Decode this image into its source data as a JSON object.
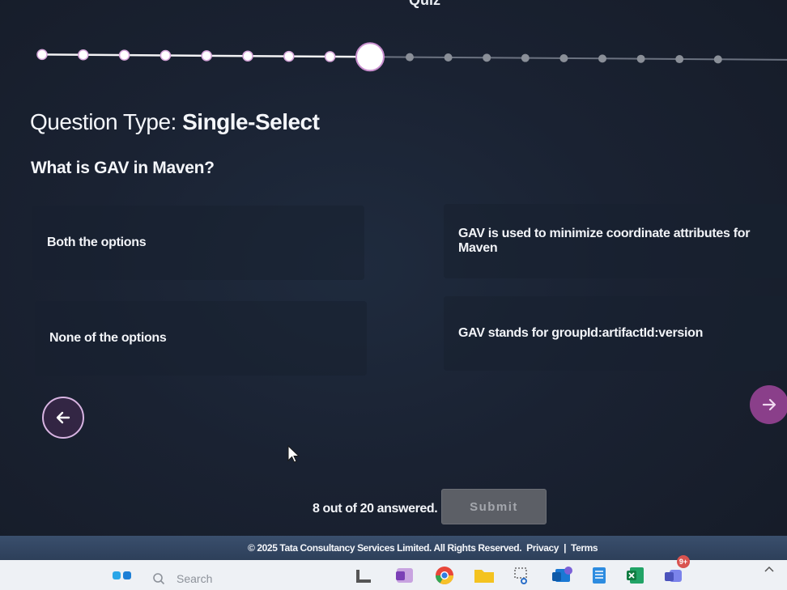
{
  "header": {
    "title": "Quiz"
  },
  "progress": {
    "total": 18,
    "completed": 8,
    "current": 9
  },
  "question": {
    "type_label": "Question Type: ",
    "type_value": "Single-Select",
    "text": "What is GAV in Maven?"
  },
  "options": [
    {
      "label": "Both the options"
    },
    {
      "label": "GAV is used to minimize coordinate attributes for Maven"
    },
    {
      "label": "None of the options"
    },
    {
      "label": "GAV stands for groupId:artifactId:version"
    }
  ],
  "status": {
    "answered_text": "8 out of 20 answered."
  },
  "buttons": {
    "submit_label": "Submit"
  },
  "footer": {
    "copyright": "© 2025 Tata Consultancy Services Limited. All Rights Reserved.",
    "privacy": "Privacy",
    "separator": "|",
    "terms": "Terms"
  },
  "taskbar": {
    "search_placeholder": "Search",
    "notification_badge": "9+",
    "apps": [
      "widgets-icon",
      "file-explorer-icon",
      "onenote-icon",
      "chrome-icon",
      "folder-icon",
      "snipping-tool-icon",
      "outlook-icon",
      "notepad-icon",
      "excel-icon",
      "teams-icon"
    ]
  },
  "colors": {
    "accent": "#8a3f8a",
    "prev_border": "#d8b4e2",
    "submit_bg": "#5c5f66"
  }
}
